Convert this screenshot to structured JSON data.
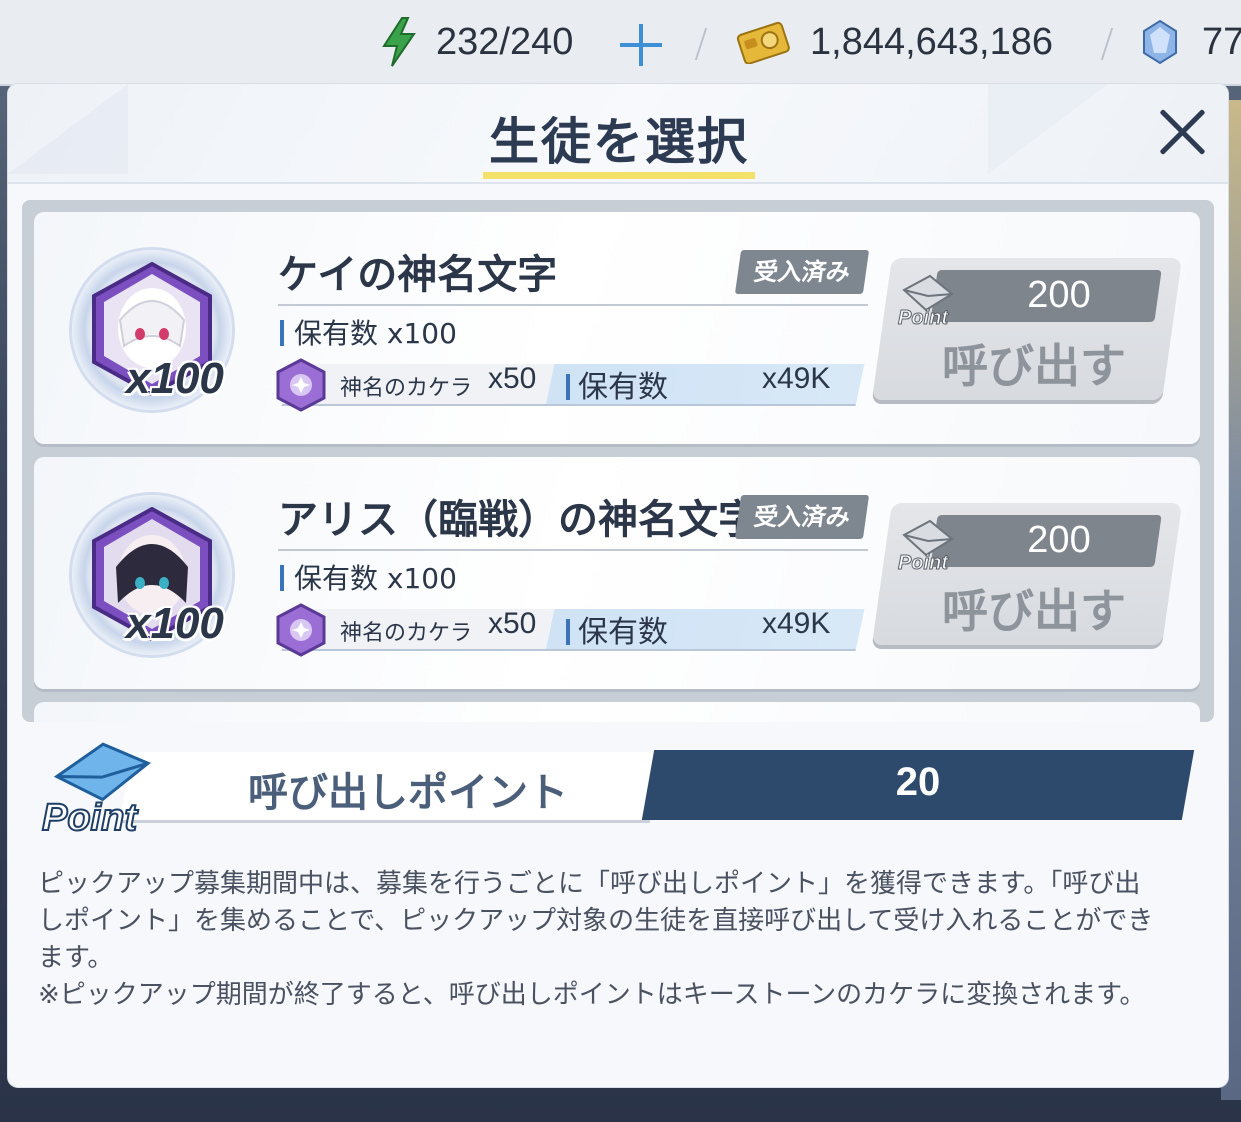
{
  "topbar": {
    "ap": "232/240",
    "credits": "1,844,643,186",
    "gems": "77",
    "colors": {
      "ap": "#3aa24a",
      "plus": "#3d8fd6"
    }
  },
  "modal": {
    "title": "生徒を選択",
    "students": [
      {
        "name": "ケイの神名文字",
        "badge": "受入済み",
        "owned": "保有数 x100",
        "portrait_qty": "x100",
        "material_name": "神名のカケラ",
        "material_qty": "x50",
        "material_owned_label": "保有数",
        "material_owned_value": "x49K",
        "cost": "200",
        "call_label": "呼び出す",
        "point_icon_label": "Point"
      },
      {
        "name": "アリス（臨戦）の神名文字",
        "badge": "受入済み",
        "owned": "保有数 x100",
        "portrait_qty": "x100",
        "material_name": "神名のカケラ",
        "material_qty": "x50",
        "material_owned_label": "保有数",
        "material_owned_value": "x49K",
        "cost": "200",
        "call_label": "呼び出す",
        "point_icon_label": "Point"
      }
    ],
    "points": {
      "icon_label": "Point",
      "label": "呼び出しポイント",
      "value": "20"
    },
    "description": [
      "ピックアップ募集期間中は、募集を行うごとに「呼び出しポイント」を獲得できます。「呼び出",
      "しポイント」を集めることで、ピックアップ対象の生徒を直接呼び出して受け入れることができ",
      "ます。",
      "※ピックアップ期間が終了すると、呼び出しポイントはキーストーンのカケラに変換されます。"
    ]
  }
}
